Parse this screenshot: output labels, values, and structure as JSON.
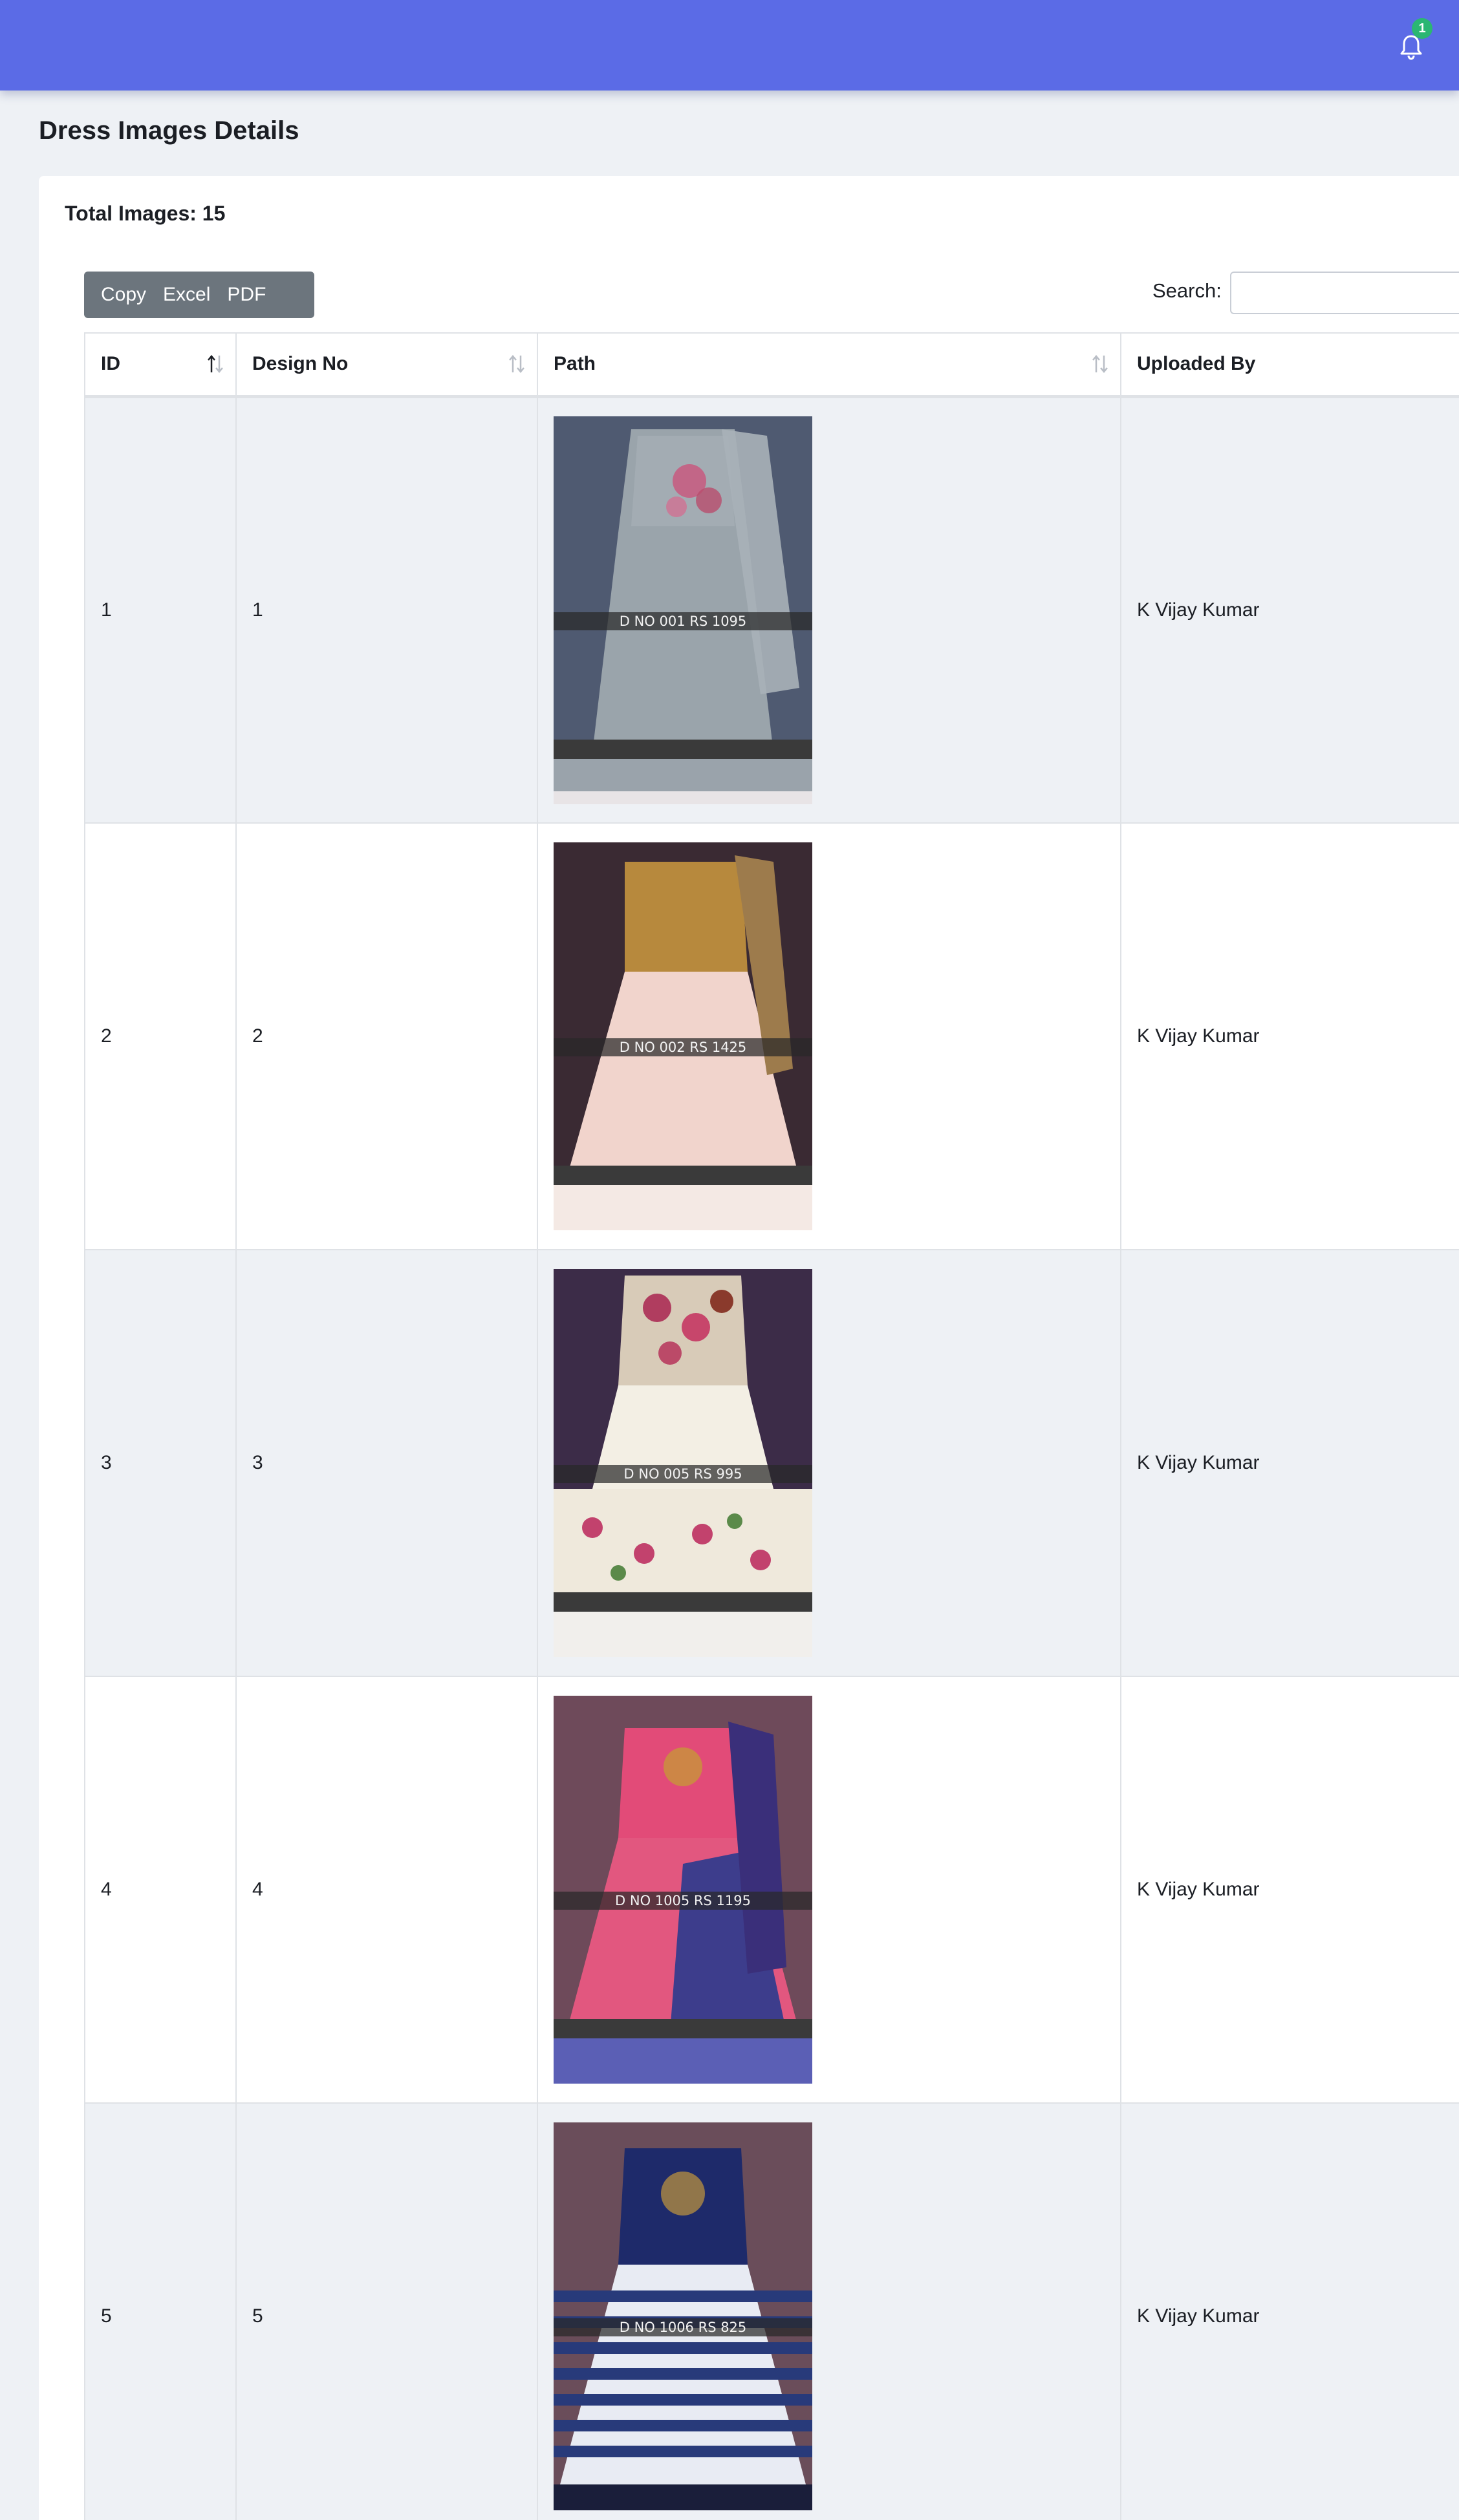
{
  "header": {
    "notification_count": "1",
    "bar_color": "#5b6be6"
  },
  "page": {
    "title": "Dress Images Details"
  },
  "card": {
    "total_label": "Total Images: 15",
    "buttons": {
      "copy": "Copy",
      "excel": "Excel",
      "pdf": "PDF"
    },
    "search_label": "Search:",
    "search_value": ""
  },
  "table": {
    "columns": [
      "ID",
      "Design No",
      "Path",
      "Uploaded By"
    ],
    "rows": [
      {
        "id": "1",
        "design_no": "1",
        "caption": "D NO 001 RS 1095",
        "uploaded_by": "K Vijay Kumar"
      },
      {
        "id": "2",
        "design_no": "2",
        "caption": "D NO 002 RS 1425",
        "uploaded_by": "K Vijay Kumar"
      },
      {
        "id": "3",
        "design_no": "3",
        "caption": "D NO 005 RS 995",
        "uploaded_by": "K Vijay Kumar"
      },
      {
        "id": "4",
        "design_no": "4",
        "caption": "D NO 1005 RS 1195",
        "uploaded_by": "K Vijay Kumar"
      },
      {
        "id": "5",
        "design_no": "5",
        "caption": "D NO 1006 RS 825",
        "uploaded_by": "K Vijay Kumar"
      }
    ]
  }
}
